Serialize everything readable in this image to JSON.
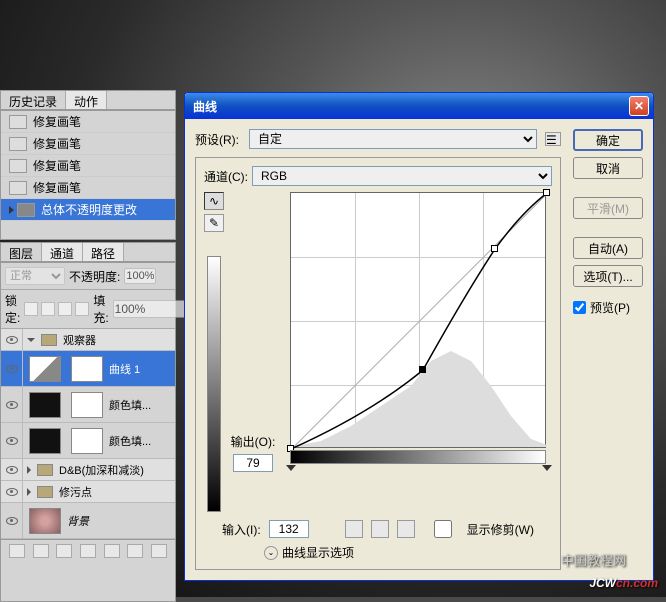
{
  "history": {
    "tab1": "历史记录",
    "tab2": "动作",
    "items": [
      {
        "label": "修复画笔"
      },
      {
        "label": "修复画笔"
      },
      {
        "label": "修复画笔"
      },
      {
        "label": "修复画笔"
      },
      {
        "label": "总体不透明度更改"
      }
    ]
  },
  "layers": {
    "tab1": "图层",
    "tab2": "通道",
    "tab3": "路径",
    "blend": "正常",
    "opacityLabel": "不透明度:",
    "opacityVal": "100%",
    "lockLabel": "锁定:",
    "fillLabel": "填充:",
    "fillVal": "100%",
    "group1": "观察器",
    "layer1": "曲线 1",
    "layer2": "颜色填...",
    "layer3": "颜色填...",
    "group2": "D&B(加深和减淡)",
    "group3": "修污点",
    "bgLayer": "背景"
  },
  "dialog": {
    "title": "曲线",
    "presetLabel": "预设(R):",
    "presetVal": "自定",
    "channelLabel": "通道(C):",
    "channelVal": "RGB",
    "outputLabel": "输出(O):",
    "outputVal": "79",
    "inputLabel": "输入(I):",
    "inputVal": "132",
    "showClip": "显示修剪(W)",
    "displayOptions": "曲线显示选项",
    "ok": "确定",
    "cancel": "取消",
    "smooth": "平滑(M)",
    "auto": "自动(A)",
    "options": "选项(T)...",
    "preview": "预览(P)"
  },
  "chart_data": {
    "type": "line",
    "title": "曲线",
    "xlabel": "输入",
    "ylabel": "输出",
    "xlim": [
      0,
      255
    ],
    "ylim": [
      0,
      255
    ],
    "series": [
      {
        "name": "curve",
        "x": [
          0,
          132,
          204,
          255
        ],
        "y": [
          0,
          79,
          200,
          255
        ]
      }
    ],
    "channel": "RGB",
    "selected_point": {
      "input": 132,
      "output": 79
    }
  },
  "watermark": {
    "line1": "中国教程网",
    "brand1": "JCW",
    "brand2": "cn.com"
  }
}
